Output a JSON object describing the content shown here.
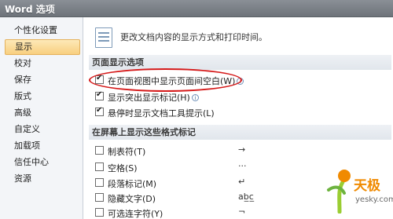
{
  "window": {
    "title": "Word 选项"
  },
  "sidebar": {
    "items": [
      {
        "label": "个性化设置"
      },
      {
        "label": "显示",
        "selected": true
      },
      {
        "label": "校对"
      },
      {
        "label": "保存"
      },
      {
        "label": "版式"
      },
      {
        "label": "高级"
      },
      {
        "label": "自定义"
      },
      {
        "label": "加载项"
      },
      {
        "label": "信任中心"
      },
      {
        "label": "资源"
      }
    ]
  },
  "header": {
    "text": "更改文档内容的显示方式和打印时间。"
  },
  "sections": {
    "page_display": {
      "title": "页面显示选项",
      "options": [
        {
          "label": "在页面视图中显示页面间空白(W)",
          "checked": true,
          "info_icon": "info-icon"
        },
        {
          "label": "显示突出显示标记(H)",
          "checked": true,
          "info_icon": "info-icon"
        },
        {
          "label": "悬停时显示文档工具提示(L)",
          "checked": true
        }
      ]
    },
    "formatting_marks": {
      "title": "在屏幕上显示这些格式标记",
      "options": [
        {
          "label": "制表符(T)",
          "checked": false,
          "mark": "→"
        },
        {
          "label": "空格(S)",
          "checked": false,
          "mark": "···"
        },
        {
          "label": "段落标记(M)",
          "checked": false,
          "mark": "↵"
        },
        {
          "label": "隐藏文字(D)",
          "checked": false,
          "mark": "ab̲c̲"
        },
        {
          "label": "可选连字符(Y)",
          "checked": false,
          "mark": "¬"
        }
      ]
    }
  },
  "watermark": {
    "brand": "天极",
    "url": "yesky.com"
  },
  "colors": {
    "selection": "#f8cf7f",
    "annotation": "#d51a1a",
    "brand": "#f08a00"
  }
}
